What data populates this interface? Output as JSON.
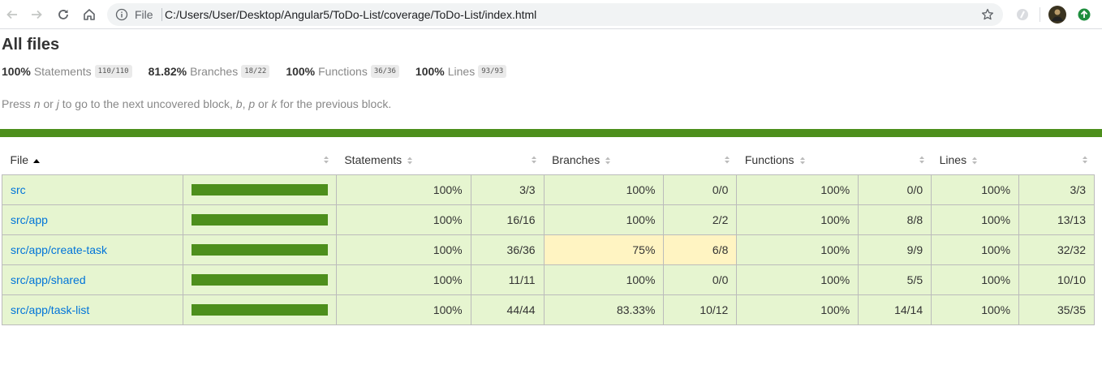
{
  "browser": {
    "file_label": "File",
    "url": "C:/Users/User/Desktop/Angular5/ToDo-List/coverage/ToDo-List/index.html"
  },
  "report": {
    "title": "All files",
    "summary": [
      {
        "pct": "100%",
        "label": "Statements",
        "fraction": "110/110"
      },
      {
        "pct": "81.82%",
        "label": "Branches",
        "fraction": "18/22"
      },
      {
        "pct": "100%",
        "label": "Functions",
        "fraction": "36/36"
      },
      {
        "pct": "100%",
        "label": "Lines",
        "fraction": "93/93"
      }
    ],
    "hint": {
      "t1": "Press ",
      "k1": "n",
      "t2": " or ",
      "k2": "j",
      "t3": " to go to the next uncovered block, ",
      "k3": "b",
      "t4": ", ",
      "k4": "p",
      "t5": " or ",
      "k5": "k",
      "t6": " for the previous block."
    },
    "status_color": "#4d8f1c",
    "columns": [
      "File",
      "Statements",
      "Branches",
      "Functions",
      "Lines"
    ],
    "rows": [
      {
        "file": "src",
        "coverage": 1.0,
        "stmt_pct": "100%",
        "stmt_abs": "3/3",
        "br_pct": "100%",
        "br_abs": "0/0",
        "fn_pct": "100%",
        "fn_abs": "0/0",
        "ln_pct": "100%",
        "ln_abs": "3/3"
      },
      {
        "file": "src/app",
        "coverage": 1.0,
        "stmt_pct": "100%",
        "stmt_abs": "16/16",
        "br_pct": "100%",
        "br_abs": "2/2",
        "fn_pct": "100%",
        "fn_abs": "8/8",
        "ln_pct": "100%",
        "ln_abs": "13/13"
      },
      {
        "file": "src/app/create-task",
        "coverage": 1.0,
        "stmt_pct": "100%",
        "stmt_abs": "36/36",
        "br_pct": "75%",
        "br_abs": "6/8",
        "fn_pct": "100%",
        "fn_abs": "9/9",
        "ln_pct": "100%",
        "ln_abs": "32/32"
      },
      {
        "file": "src/app/shared",
        "coverage": 1.0,
        "stmt_pct": "100%",
        "stmt_abs": "11/11",
        "br_pct": "100%",
        "br_abs": "0/0",
        "fn_pct": "100%",
        "fn_abs": "5/5",
        "ln_pct": "100%",
        "ln_abs": "10/10"
      },
      {
        "file": "src/app/task-list",
        "coverage": 1.0,
        "stmt_pct": "100%",
        "stmt_abs": "44/44",
        "br_pct": "83.33%",
        "br_abs": "10/12",
        "fn_pct": "100%",
        "fn_abs": "14/14",
        "ln_pct": "100%",
        "ln_abs": "35/35"
      }
    ]
  },
  "icons": [
    "back-icon",
    "forward-icon",
    "reload-icon",
    "home-icon",
    "info-icon",
    "star-icon",
    "extension-icon",
    "avatar",
    "update-icon"
  ]
}
